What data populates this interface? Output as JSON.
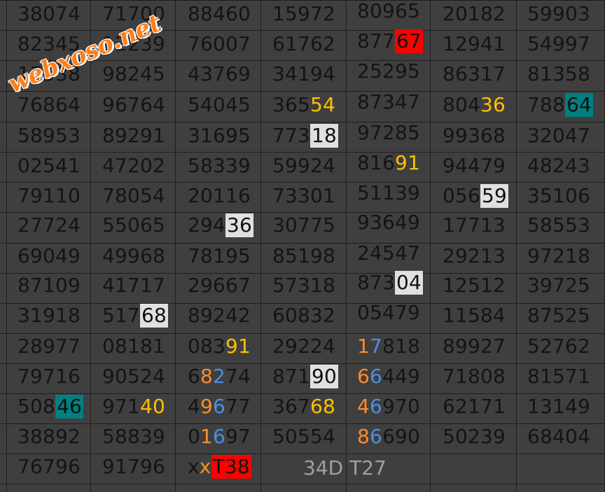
{
  "colors": {
    "background": "#3f3f3f",
    "text": "#141414",
    "red_bg": "#ff0000",
    "teal_bg": "#008080",
    "light_bg": "#e0e0e0",
    "gold": "#ffc000",
    "orange": "#ff8c2a",
    "blue": "#4a90e2",
    "caption": "#a0a0a0"
  },
  "watermark": "webxoso.net",
  "caption": "34D T27",
  "rows": [
    [
      [
        {
          "t": "38074"
        }
      ],
      [
        {
          "t": "71700"
        }
      ],
      [
        {
          "t": "88460"
        }
      ],
      [
        {
          "t": "15972"
        }
      ],
      [
        {
          "t": "80965"
        }
      ],
      [
        {
          "t": "20182"
        }
      ],
      [
        {
          "t": "59903"
        }
      ]
    ],
    [
      [
        {
          "t": "82345"
        }
      ],
      [
        {
          "t": "12239"
        }
      ],
      [
        {
          "t": "76007"
        }
      ],
      [
        {
          "t": "61762"
        }
      ],
      [
        {
          "t": "877"
        },
        {
          "t": "67",
          "s": "red"
        }
      ],
      [
        {
          "t": "12941"
        }
      ],
      [
        {
          "t": "54997"
        }
      ]
    ],
    [
      [
        {
          "t": "17538"
        }
      ],
      [
        {
          "t": "98245"
        }
      ],
      [
        {
          "t": "43769"
        }
      ],
      [
        {
          "t": "34194"
        }
      ],
      [
        {
          "t": "25295"
        }
      ],
      [
        {
          "t": "86317"
        }
      ],
      [
        {
          "t": "81358"
        }
      ]
    ],
    [
      [
        {
          "t": "76864"
        }
      ],
      [
        {
          "t": "96764"
        }
      ],
      [
        {
          "t": "54045"
        }
      ],
      [
        {
          "t": "365"
        },
        {
          "t": "54",
          "s": "gold"
        }
      ],
      [
        {
          "t": "87347"
        }
      ],
      [
        {
          "t": "804"
        },
        {
          "t": "36",
          "s": "gold"
        }
      ],
      [
        {
          "t": "788"
        },
        {
          "t": "64",
          "s": "teal"
        }
      ]
    ],
    [
      [
        {
          "t": "58953"
        }
      ],
      [
        {
          "t": "89291"
        }
      ],
      [
        {
          "t": "31695"
        }
      ],
      [
        {
          "t": "773"
        },
        {
          "t": "18",
          "s": "light"
        }
      ],
      [
        {
          "t": "97285"
        }
      ],
      [
        {
          "t": "99368"
        }
      ],
      [
        {
          "t": "32047"
        }
      ]
    ],
    [
      [
        {
          "t": "02541"
        }
      ],
      [
        {
          "t": "47202"
        }
      ],
      [
        {
          "t": "58339"
        }
      ],
      [
        {
          "t": "59924"
        }
      ],
      [
        {
          "t": "816"
        },
        {
          "t": "91",
          "s": "gold"
        }
      ],
      [
        {
          "t": "94479"
        }
      ],
      [
        {
          "t": "48243"
        }
      ]
    ],
    [
      [
        {
          "t": "79110"
        }
      ],
      [
        {
          "t": "78054"
        }
      ],
      [
        {
          "t": "20116"
        }
      ],
      [
        {
          "t": "73301"
        }
      ],
      [
        {
          "t": "51139"
        }
      ],
      [
        {
          "t": "056"
        },
        {
          "t": "59",
          "s": "light"
        }
      ],
      [
        {
          "t": "35106"
        }
      ]
    ],
    [
      [
        {
          "t": "27724"
        }
      ],
      [
        {
          "t": "55065"
        }
      ],
      [
        {
          "t": "294"
        },
        {
          "t": "36",
          "s": "light"
        }
      ],
      [
        {
          "t": "30775"
        }
      ],
      [
        {
          "t": "93649"
        }
      ],
      [
        {
          "t": "17713"
        }
      ],
      [
        {
          "t": "58553"
        }
      ]
    ],
    [
      [
        {
          "t": "69049"
        }
      ],
      [
        {
          "t": "49968"
        }
      ],
      [
        {
          "t": "78195"
        }
      ],
      [
        {
          "t": "85198"
        }
      ],
      [
        {
          "t": "24547"
        }
      ],
      [
        {
          "t": "29213"
        }
      ],
      [
        {
          "t": "97218"
        }
      ]
    ],
    [
      [
        {
          "t": "87109"
        }
      ],
      [
        {
          "t": "41717"
        }
      ],
      [
        {
          "t": "29667"
        }
      ],
      [
        {
          "t": "57318"
        }
      ],
      [
        {
          "t": "873"
        },
        {
          "t": "04",
          "s": "light"
        }
      ],
      [
        {
          "t": "12512"
        }
      ],
      [
        {
          "t": "39725"
        }
      ]
    ],
    [
      [
        {
          "t": "31918"
        }
      ],
      [
        {
          "t": "517"
        },
        {
          "t": "68",
          "s": "light"
        }
      ],
      [
        {
          "t": "89242"
        }
      ],
      [
        {
          "t": "60832"
        }
      ],
      [
        {
          "t": "05479"
        }
      ],
      [
        {
          "t": "11584"
        }
      ],
      [
        {
          "t": "87525"
        }
      ]
    ],
    [
      [
        {
          "t": "28977"
        }
      ],
      [
        {
          "t": "08181"
        }
      ],
      [
        {
          "t": "083"
        },
        {
          "t": "91",
          "s": "gold"
        }
      ],
      [
        {
          "t": "29224"
        }
      ],
      [
        {
          "t": "1",
          "s": "orange"
        },
        {
          "t": "7",
          "s": "blue"
        },
        {
          "t": "818"
        }
      ],
      [
        {
          "t": "89927"
        }
      ],
      [
        {
          "t": "52762"
        }
      ]
    ],
    [
      [
        {
          "t": "79716"
        }
      ],
      [
        {
          "t": "90524"
        }
      ],
      [
        {
          "t": "6"
        },
        {
          "t": "8",
          "s": "orange"
        },
        {
          "t": "2",
          "s": "blue"
        },
        {
          "t": "74"
        }
      ],
      [
        {
          "t": "871"
        },
        {
          "t": "90",
          "s": "light"
        }
      ],
      [
        {
          "t": "6",
          "s": "orange"
        },
        {
          "t": "6",
          "s": "blue"
        },
        {
          "t": "449"
        }
      ],
      [
        {
          "t": "71808"
        }
      ],
      [
        {
          "t": "81571"
        }
      ]
    ],
    [
      [
        {
          "t": "508"
        },
        {
          "t": "46",
          "s": "teal"
        }
      ],
      [
        {
          "t": "971"
        },
        {
          "t": "40",
          "s": "gold"
        }
      ],
      [
        {
          "t": "4"
        },
        {
          "t": "9",
          "s": "orange"
        },
        {
          "t": "6",
          "s": "blue"
        },
        {
          "t": "77"
        }
      ],
      [
        {
          "t": "367"
        },
        {
          "t": "68",
          "s": "gold"
        }
      ],
      [
        {
          "t": "4",
          "s": "orange"
        },
        {
          "t": "6",
          "s": "blue"
        },
        {
          "t": "970"
        }
      ],
      [
        {
          "t": "62171"
        }
      ],
      [
        {
          "t": "13149"
        }
      ]
    ],
    [
      [
        {
          "t": "38892"
        }
      ],
      [
        {
          "t": "58839"
        }
      ],
      [
        {
          "t": "0"
        },
        {
          "t": "1",
          "s": "orange"
        },
        {
          "t": "6",
          "s": "blue"
        },
        {
          "t": "97"
        }
      ],
      [
        {
          "t": "50554"
        }
      ],
      [
        {
          "t": "8",
          "s": "orange"
        },
        {
          "t": "6",
          "s": "blue"
        },
        {
          "t": "690"
        }
      ],
      [
        {
          "t": "50239"
        }
      ],
      [
        {
          "t": "68404"
        }
      ]
    ],
    [
      [
        {
          "t": "76796"
        }
      ],
      [
        {
          "t": "91796"
        }
      ],
      [
        {
          "t": "x"
        },
        {
          "t": "x",
          "s": "orange"
        },
        {
          "t": "T38",
          "s": "red"
        }
      ],
      [],
      [],
      [],
      []
    ]
  ]
}
